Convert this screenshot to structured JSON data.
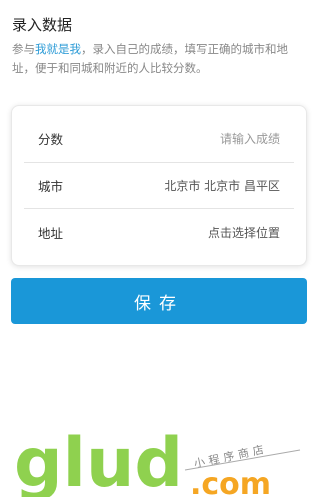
{
  "header": {
    "title": "录入数据",
    "desc_prefix": "参与",
    "desc_link": "我就是我",
    "desc_rest": "，录入自己的成绩，填写正确的城市和地址，便于和同城和附近的人比较分数。"
  },
  "form": {
    "score": {
      "label": "分数",
      "placeholder": "请输入成绩"
    },
    "city": {
      "label": "城市",
      "value": "北京市 北京市 昌平区"
    },
    "address": {
      "label": "地址",
      "value": "点击选择位置"
    }
  },
  "save_label": "保存",
  "watermark": {
    "logo_text": "glud",
    "sub_text": "小程序商店",
    "domain_text": ".com"
  },
  "colors": {
    "accent": "#1a97d8",
    "link": "#2a9ad6",
    "watermark_green": "#8fd14f",
    "watermark_orange": "#f5a623"
  }
}
